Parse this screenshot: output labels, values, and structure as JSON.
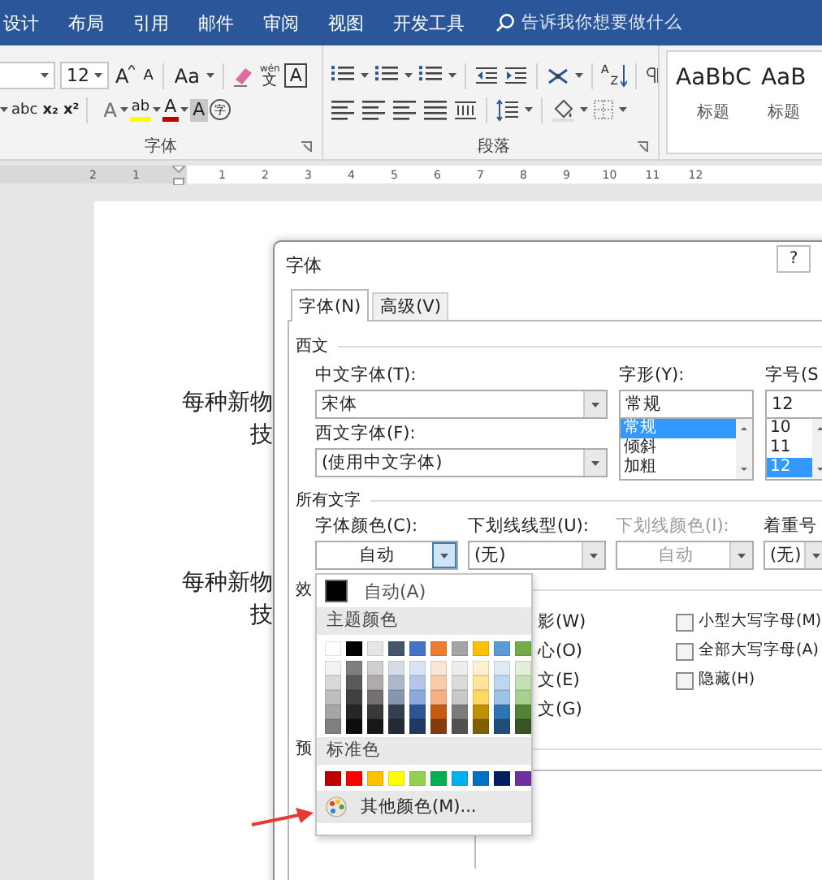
{
  "ribbon_tabs": [
    {
      "label": "设计",
      "selected": false
    },
    {
      "label": "布局",
      "selected": false
    },
    {
      "label": "引用",
      "selected": false
    },
    {
      "label": "邮件",
      "selected": false
    },
    {
      "label": "审阅",
      "selected": false
    },
    {
      "label": "视图",
      "selected": false
    },
    {
      "label": "开发工具",
      "selected": false
    }
  ],
  "tell_me": {
    "placeholder": "告诉我你想要做什么"
  },
  "font_group": {
    "label": "字体",
    "size": "12",
    "grow_font": "A",
    "shrink_font": "A",
    "change_case": "Aa",
    "phonetic_top": "wén",
    "phonetic": "文",
    "char_border": "A",
    "strikethrough": "abc",
    "subscript": "x₂",
    "superscript": "x²",
    "text_effects": "A",
    "highlight": "ab",
    "font_color": "A",
    "char_shading": "A",
    "enclose": "字"
  },
  "paragraph_group": {
    "label": "段落",
    "sort_top": "A",
    "sort_bottom": "Z"
  },
  "styles": [
    {
      "preview": "AaBbC",
      "name": "标题"
    },
    {
      "preview": "AaB",
      "name": "标题"
    }
  ],
  "ruler": [
    "2",
    "1",
    "1",
    "2",
    "3",
    "4",
    "5",
    "6",
    "7",
    "8",
    "9",
    "10",
    "11",
    "12"
  ],
  "document": [
    {
      "lines": [
        "每种新物",
        "技"
      ]
    },
    {
      "lines": [
        "每种新物",
        "技"
      ]
    }
  ],
  "dialog": {
    "title": "字体",
    "help": "?",
    "tabs": [
      {
        "label": "字体(N)",
        "selected": true
      },
      {
        "label": "高级(V)",
        "selected": false
      }
    ],
    "western": {
      "heading": "西文",
      "asian_font": {
        "label": "中文字体(T):",
        "value": "宋体"
      },
      "latin_font": {
        "label": "西文字体(F):",
        "value": "(使用中文字体)"
      },
      "style": {
        "label": "字形(Y):",
        "value": "常规",
        "options": [
          {
            "label": "常规",
            "selected": true
          },
          {
            "label": "倾斜",
            "selected": false
          },
          {
            "label": "加粗",
            "selected": false
          }
        ]
      },
      "size": {
        "label": "字号(S",
        "value": "12",
        "options": [
          {
            "label": "10",
            "selected": false
          },
          {
            "label": "11",
            "selected": false
          },
          {
            "label": "12",
            "selected": true
          }
        ]
      }
    },
    "all_text": {
      "heading": "所有文字",
      "fields": [
        {
          "kind": "color",
          "label": "字体颜色(C):",
          "value": "自动",
          "expanded": true,
          "disabled": false
        },
        {
          "kind": "list",
          "label": "下划线线型(U):",
          "value": "(无)",
          "expanded": false,
          "disabled": false
        },
        {
          "kind": "color",
          "label": "下划线颜色(I):",
          "value": "自动",
          "expanded": false,
          "disabled": true
        },
        {
          "kind": "list",
          "label": "着重号",
          "value": "(无)",
          "expanded": false,
          "disabled": false
        }
      ]
    },
    "effects": {
      "heading": "效",
      "fragments": [
        "影(W)",
        "心(O)",
        "文(E)",
        "文(G)"
      ],
      "options": [
        {
          "label": "小型大写字母(M)",
          "checked": false
        },
        {
          "label": "全部大写字母(A)",
          "checked": false
        },
        {
          "label": "隐藏(H)",
          "checked": false
        }
      ]
    },
    "preview": {
      "heading": "预"
    }
  },
  "color_menu": {
    "automatic": {
      "label": "自动(A)",
      "color": "#000000"
    },
    "theme_heading": "主题颜色",
    "theme_rows": [
      [
        {
          "color": "#ffffff"
        },
        {
          "color": "#000000"
        },
        {
          "color": "#e7e6e6"
        },
        {
          "color": "#44546a"
        },
        {
          "color": "#4472c4"
        },
        {
          "color": "#ed7d31"
        },
        {
          "color": "#a5a5a5"
        },
        {
          "color": "#ffc000"
        },
        {
          "color": "#5b9bd5"
        },
        {
          "color": "#70ad47"
        }
      ],
      [
        {
          "color": "#f2f2f2"
        },
        {
          "color": "#7f7f7f"
        },
        {
          "color": "#d0cece"
        },
        {
          "color": "#d6dce4"
        },
        {
          "color": "#d9e2f3"
        },
        {
          "color": "#fbe5d5"
        },
        {
          "color": "#ededed"
        },
        {
          "color": "#fff2cc"
        },
        {
          "color": "#deebf6"
        },
        {
          "color": "#e2efd9"
        }
      ],
      [
        {
          "color": "#d9d9d9"
        },
        {
          "color": "#595959"
        },
        {
          "color": "#aeabab"
        },
        {
          "color": "#adb9ca"
        },
        {
          "color": "#b4c6e7"
        },
        {
          "color": "#f7cbac"
        },
        {
          "color": "#dbdbdb"
        },
        {
          "color": "#fee599"
        },
        {
          "color": "#bdd7ee"
        },
        {
          "color": "#c5e0b3"
        }
      ],
      [
        {
          "color": "#bfbfbf"
        },
        {
          "color": "#404040"
        },
        {
          "color": "#757171"
        },
        {
          "color": "#8496b0"
        },
        {
          "color": "#8eaadb"
        },
        {
          "color": "#f4b183"
        },
        {
          "color": "#c9c9c9"
        },
        {
          "color": "#ffd966"
        },
        {
          "color": "#9dc3e6"
        },
        {
          "color": "#a8d08d"
        }
      ],
      [
        {
          "color": "#a6a6a6"
        },
        {
          "color": "#262626"
        },
        {
          "color": "#3b3838"
        },
        {
          "color": "#333f4f"
        },
        {
          "color": "#2f5496"
        },
        {
          "color": "#c55a11"
        },
        {
          "color": "#7b7b7b"
        },
        {
          "color": "#bf9000"
        },
        {
          "color": "#2e75b5"
        },
        {
          "color": "#538135"
        }
      ],
      [
        {
          "color": "#808080"
        },
        {
          "color": "#0d0d0d"
        },
        {
          "color": "#181717"
        },
        {
          "color": "#222a35"
        },
        {
          "color": "#1f3864"
        },
        {
          "color": "#843c0b"
        },
        {
          "color": "#525252"
        },
        {
          "color": "#7f6000"
        },
        {
          "color": "#1e4e79"
        },
        {
          "color": "#375623"
        }
      ]
    ],
    "standard_heading": "标准色",
    "standard": [
      {
        "color": "#c00000"
      },
      {
        "color": "#ff0000"
      },
      {
        "color": "#ffc000"
      },
      {
        "color": "#ffff00"
      },
      {
        "color": "#92d050"
      },
      {
        "color": "#00b050"
      },
      {
        "color": "#00b0f0"
      },
      {
        "color": "#0070c0"
      },
      {
        "color": "#002060"
      },
      {
        "color": "#7030a0"
      }
    ],
    "more": "其他颜色(M)..."
  }
}
